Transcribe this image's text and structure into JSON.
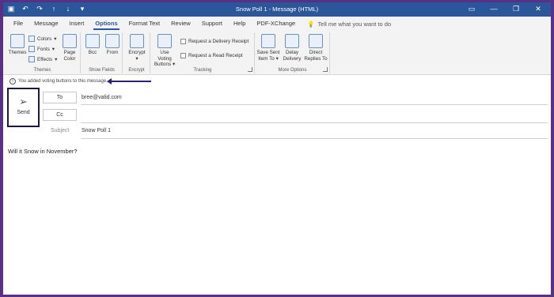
{
  "window": {
    "title": "Snow Poll 1  -  Message (HTML)"
  },
  "tabs": [
    "File",
    "Message",
    "Insert",
    "Options",
    "Format Text",
    "Review",
    "Support",
    "Help",
    "PDF-XChange"
  ],
  "active_tab": "Options",
  "tell_me": "Tell me what you want to do",
  "ribbon": {
    "themes": {
      "themes_label": "Themes",
      "colors_label": "Colors",
      "fonts_label": "Fonts",
      "effects_label": "Effects",
      "page_label": "Page",
      "color_label": "Color",
      "group_label": "Themes"
    },
    "show_fields": {
      "bcc_label": "Bcc",
      "from_label": "From",
      "group_label": "Show Fields"
    },
    "encrypt": {
      "encrypt_label": "Encrypt",
      "group_label": "Encrypt"
    },
    "tracking": {
      "use_label": "Use Voting",
      "buttons_label": "Buttons",
      "delivery_receipt": "Request a Delivery Receipt",
      "read_receipt": "Request a Read Receipt",
      "group_label": "Tracking"
    },
    "more_options": {
      "save_sent_1": "Save Sent",
      "save_sent_2": "Item To",
      "delay_1": "Delay",
      "delay_2": "Delivery",
      "direct_1": "Direct",
      "direct_2": "Replies To",
      "group_label": "More Options"
    }
  },
  "infobar": {
    "message": "You added voting buttons to this message."
  },
  "compose": {
    "send_label": "Send",
    "to_label": "To",
    "cc_label": "Cc",
    "subject_label": "Subject",
    "to_value": "bree@valid.com",
    "cc_value": "",
    "subject_value": "Snow Poll 1"
  },
  "body": {
    "text": "Will it Snow in November?"
  },
  "colors": {
    "titlebar": "#2b579a",
    "frame": "#5a2f86",
    "arrow": "#2b2270"
  }
}
